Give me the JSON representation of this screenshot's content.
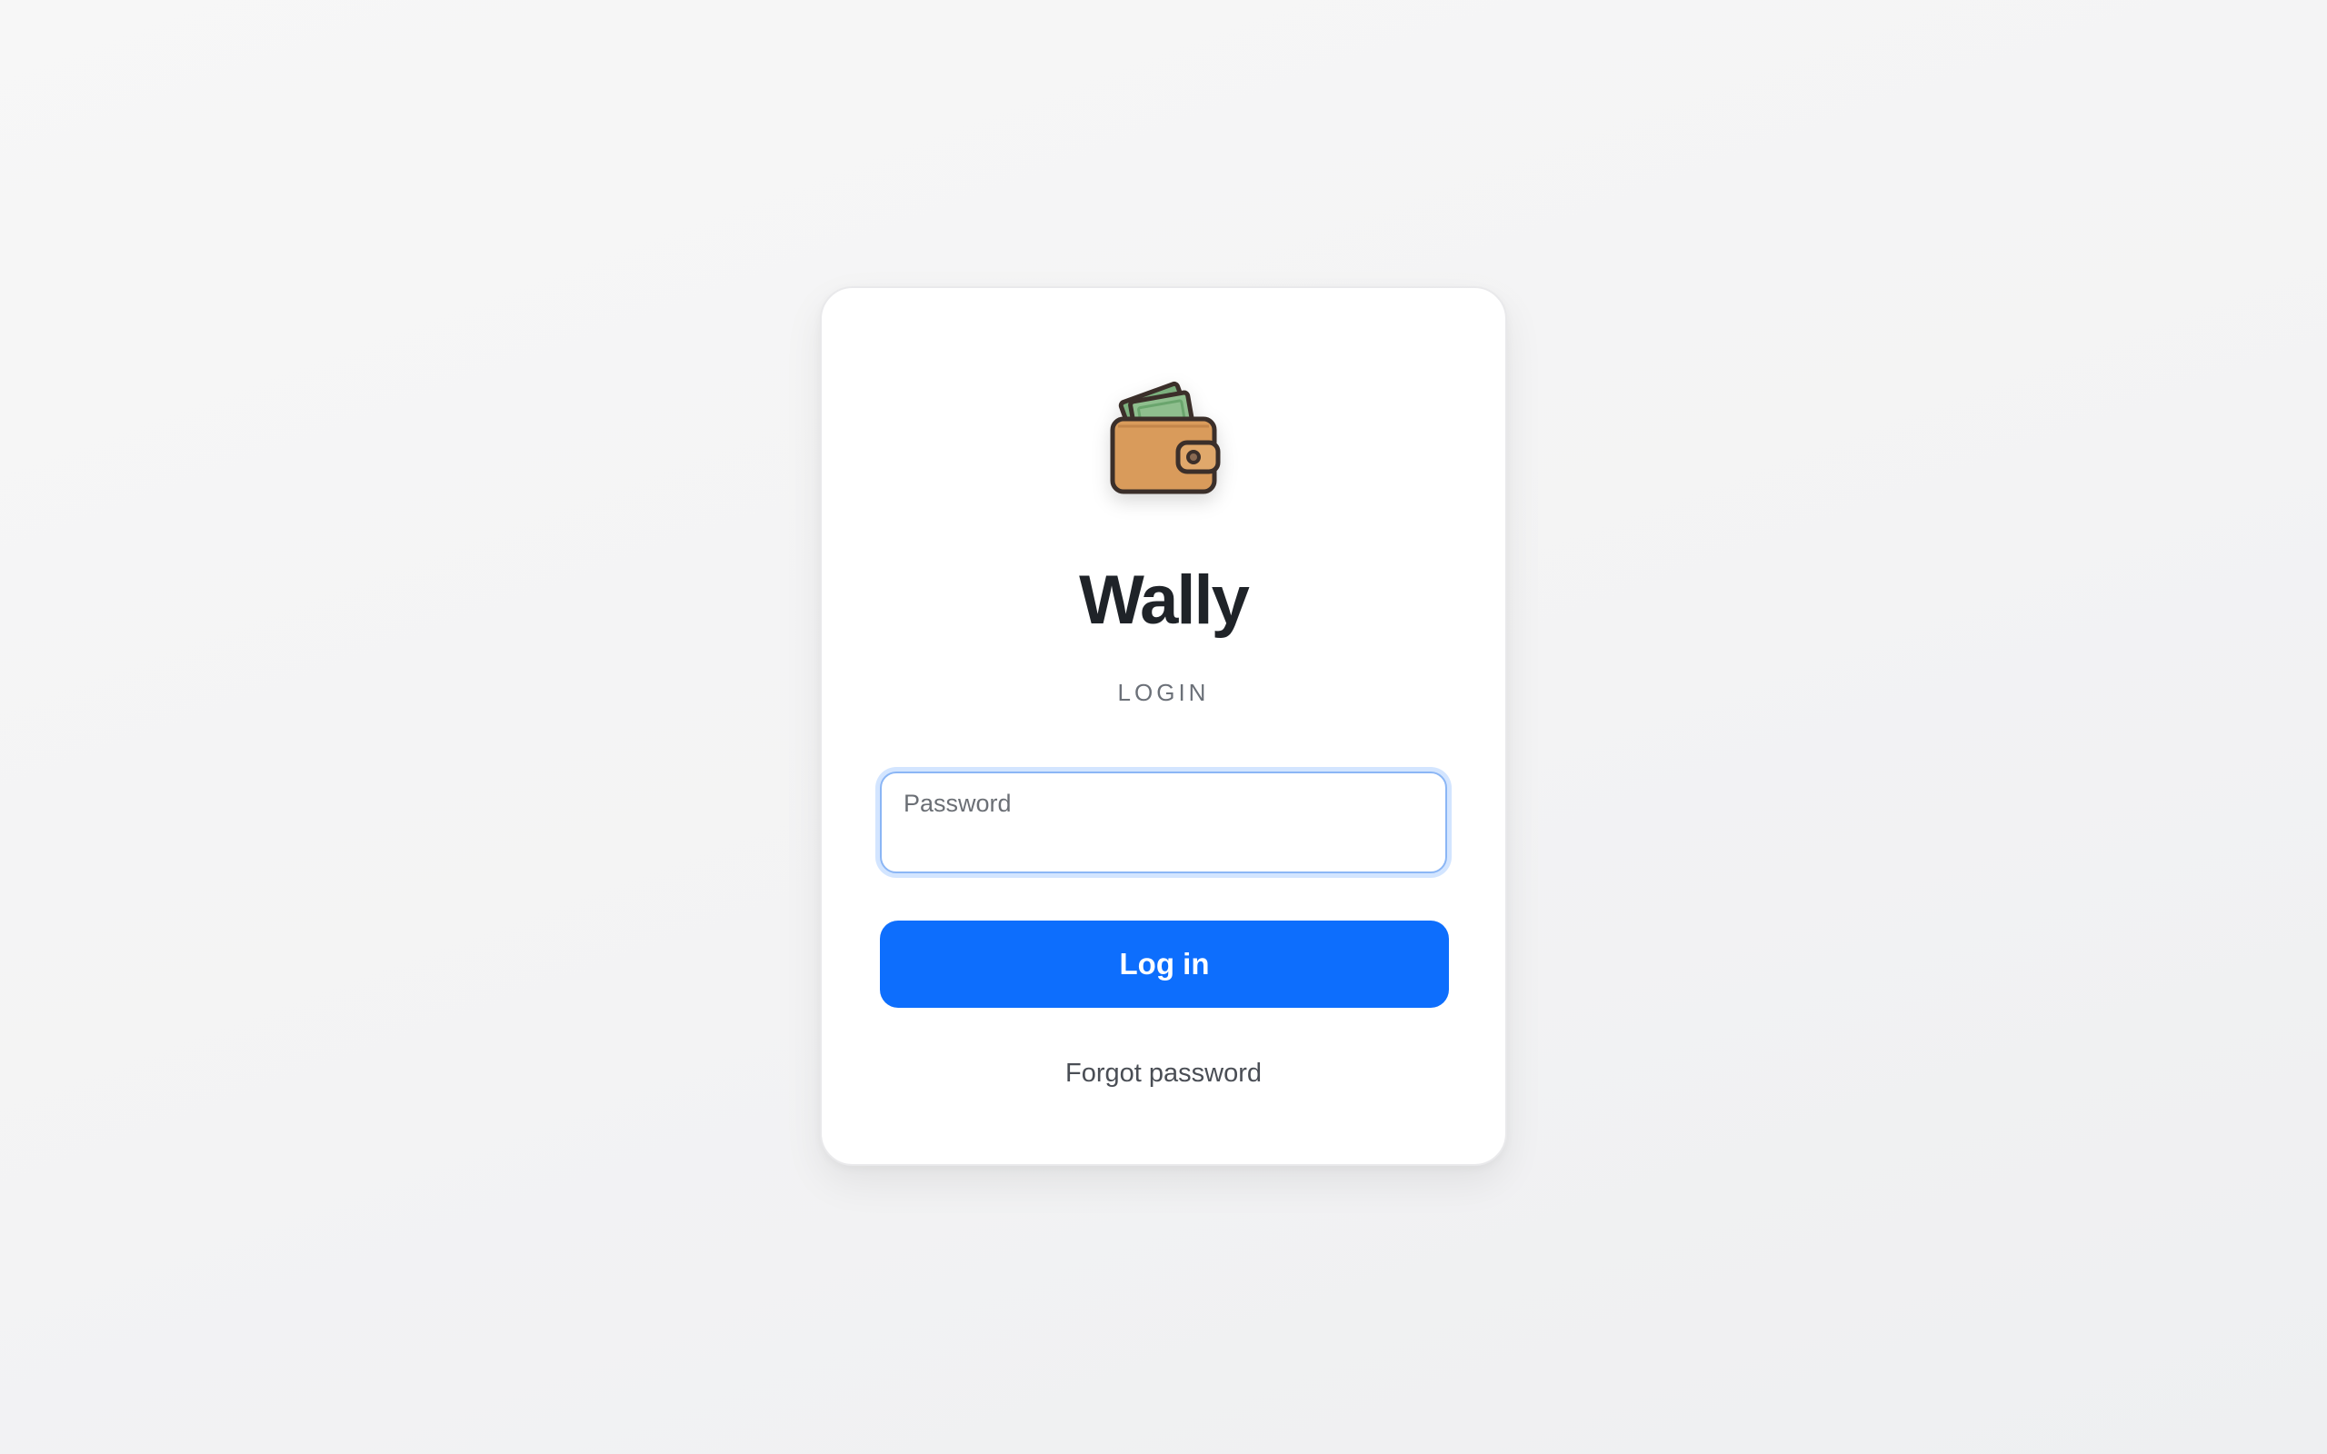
{
  "app": {
    "name": "Wally",
    "subtitle": "LOGIN",
    "logo_icon": "wallet-icon"
  },
  "form": {
    "password_label": "Password",
    "password_value": "",
    "submit_label": "Log in",
    "forgot_label": "Forgot password"
  },
  "colors": {
    "accent": "#0d6efd",
    "focus_ring": "#8bb6f5",
    "title": "#1f2328",
    "wallet_body": "#d99b5b",
    "wallet_outline": "#3b2f2a",
    "cash": "#7cb07e"
  }
}
